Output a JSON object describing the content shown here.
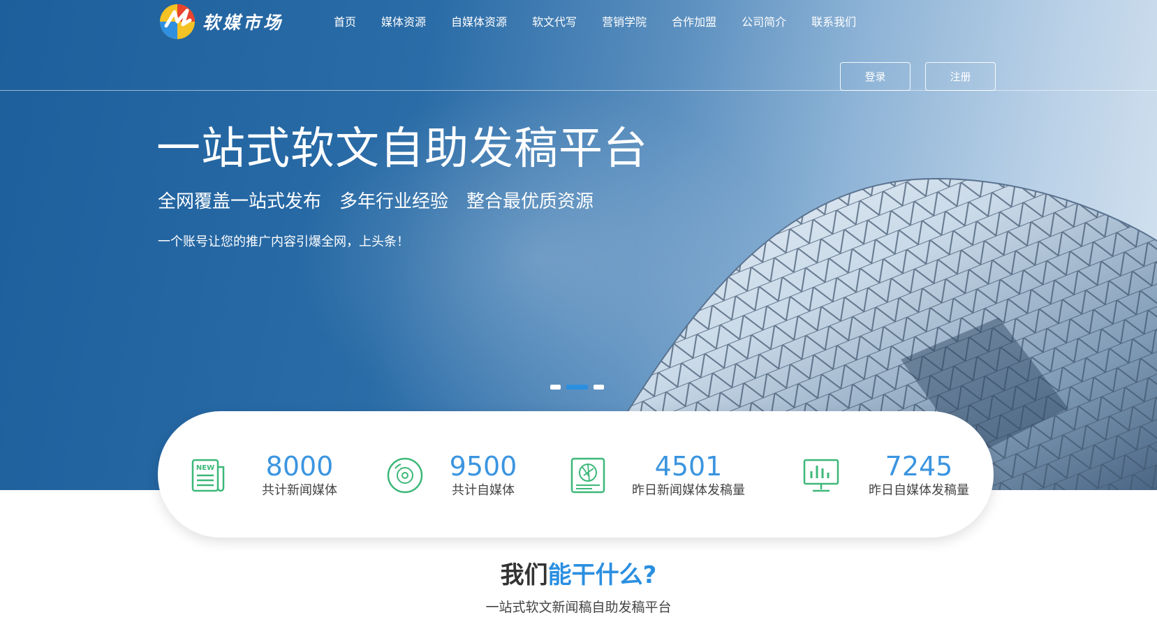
{
  "brand": {
    "name": "软媒市场"
  },
  "nav": {
    "items": [
      {
        "label": "首页"
      },
      {
        "label": "媒体资源"
      },
      {
        "label": "自媒体资源"
      },
      {
        "label": "软文代写"
      },
      {
        "label": "营销学院"
      },
      {
        "label": "合作加盟"
      },
      {
        "label": "公司简介"
      },
      {
        "label": "联系我们"
      }
    ]
  },
  "auth": {
    "login_label": "登录",
    "register_label": "注册"
  },
  "hero": {
    "title": "一站式软文自助发稿平台",
    "subtitles": [
      "全网覆盖一站式发布",
      "多年行业经验",
      "整合最优质资源"
    ],
    "tagline": "一个账号让您的推广内容引爆全网，上头条！",
    "carousel": {
      "slides": 3,
      "active_index": 2
    }
  },
  "stats": [
    {
      "number": "8000",
      "label": "共计新闻媒体",
      "icon": "newspaper-icon"
    },
    {
      "number": "9500",
      "label": "共计自媒体",
      "icon": "disc-icon"
    },
    {
      "number": "4501",
      "label": "昨日新闻媒体发稿量",
      "icon": "camera-aperture-icon"
    },
    {
      "number": "7245",
      "label": "昨日自媒体发稿量",
      "icon": "monitor-chart-icon"
    }
  ],
  "section": {
    "title_prefix": "我们",
    "title_highlight": "能干什么?",
    "subtitle": "一站式软文新闻稿自助发稿平台"
  },
  "colors": {
    "hero_blue": "#1d5f9c",
    "accent": "#2b8fe0",
    "icon_green": "#3cb878",
    "number_blue": "#3b95e0"
  }
}
